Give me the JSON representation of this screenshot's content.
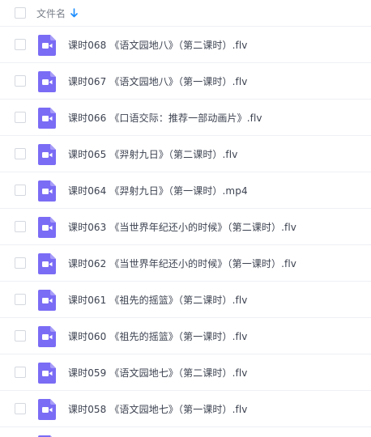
{
  "header": {
    "name_label": "文件名",
    "sort_icon": "arrow-down-icon",
    "sort_color": "#1a8cff"
  },
  "colors": {
    "video_icon": "#7b6cf5",
    "video_icon_fold": "#a79cf8"
  },
  "files": [
    {
      "name": "课时068 《语文园地八》（第二课时）.flv",
      "icon": "video-file-icon"
    },
    {
      "name": "课时067 《语文园地八》（第一课时）.flv",
      "icon": "video-file-icon"
    },
    {
      "name": "课时066 《口语交际：推荐一部动画片》.flv",
      "icon": "video-file-icon"
    },
    {
      "name": "课时065 《羿射九日》（第二课时）.flv",
      "icon": "video-file-icon"
    },
    {
      "name": "课时064 《羿射九日》（第一课时）.mp4",
      "icon": "video-file-icon"
    },
    {
      "name": "课时063 《当世界年纪还小的时候》（第二课时）.flv",
      "icon": "video-file-icon"
    },
    {
      "name": "课时062 《当世界年纪还小的时候》（第一课时）.flv",
      "icon": "video-file-icon"
    },
    {
      "name": "课时061 《祖先的摇篮》（第二课时）.flv",
      "icon": "video-file-icon"
    },
    {
      "name": "课时060 《祖先的摇篮》（第一课时）.flv",
      "icon": "video-file-icon"
    },
    {
      "name": "课时059 《语文园地七》（第二课时）.flv",
      "icon": "video-file-icon"
    },
    {
      "name": "课时058 《语文园地七》（第一课时）.flv",
      "icon": "video-file-icon"
    }
  ]
}
